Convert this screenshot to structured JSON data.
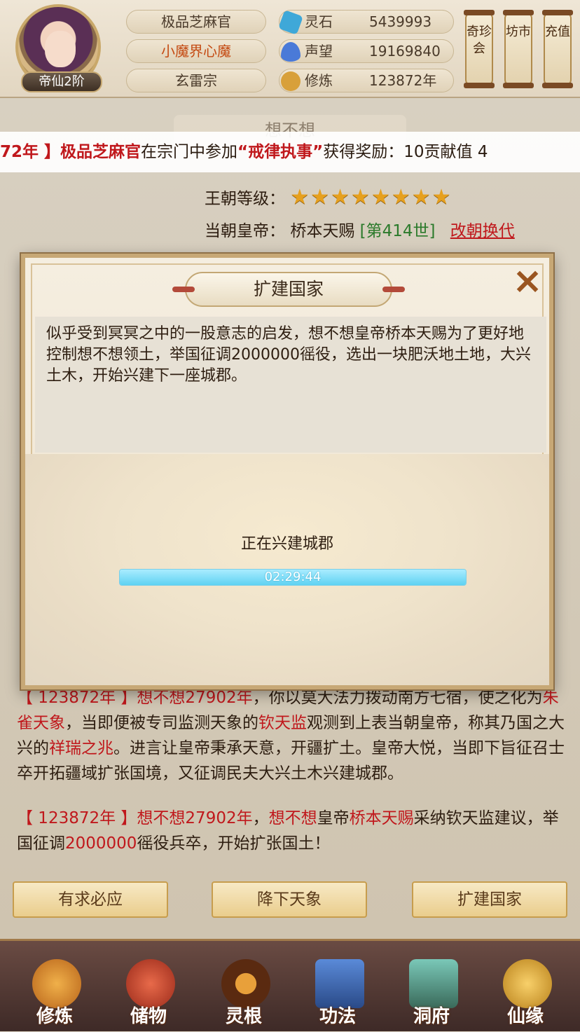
{
  "header": {
    "realm": "帝仙2阶",
    "title_pill": "极品芝麻官",
    "name_pill": "小魔界心魔",
    "sect_pill": "玄雷宗",
    "resources": [
      {
        "label": "灵石",
        "value": "5439993",
        "icon": "spirit-stone-icon",
        "color": "#3fa8d8"
      },
      {
        "label": "声望",
        "value": "19169840",
        "icon": "prestige-crystal-icon",
        "color": "#4a7ad8"
      },
      {
        "label": "修炼",
        "value": "123872年",
        "icon": "meditation-icon",
        "color": "#d8a03a"
      }
    ],
    "side_buttons": [
      "奇珍会",
      "坊市",
      "充值"
    ]
  },
  "page": {
    "title": "想不想",
    "ticker": {
      "part1": "72年 】",
      "name": "极品芝麻官",
      "part2": "在宗门中参加",
      "event": "“戒律执事”",
      "part3": "获得奖励：10贡献值 4"
    },
    "dynasty_level_label": "王朝等级：",
    "stars": 8,
    "emperor_label": "当朝皇帝：",
    "emperor_name": "桥本天赐",
    "generation": "[第414世]",
    "change_dynasty": "改朝换代"
  },
  "log": [
    {
      "segments": [
        {
          "t": "【 123872年 】想不想27902年",
          "c": "r"
        },
        {
          "t": "，你以莫大法力拨动南方七宿，使之",
          "c": ""
        },
        {
          "t": "化为",
          "c": ""
        },
        {
          "t": "朱雀天象",
          "c": "r"
        },
        {
          "t": "，当即便被专司监测天象的",
          "c": ""
        },
        {
          "t": "钦天监",
          "c": "r"
        },
        {
          "t": "观测到上表当朝皇帝，称其乃国之大兴的",
          "c": ""
        },
        {
          "t": "祥瑞之兆",
          "c": "r"
        },
        {
          "t": "。进言让皇帝秉承天意，开疆扩土。皇帝大悦，当即下旨征召士卒开拓疆域扩张国境，又征调民夫大兴土木兴建城郡。",
          "c": ""
        }
      ]
    },
    {
      "segments": [
        {
          "t": "【 123872年 】想不想27902年",
          "c": "r"
        },
        {
          "t": "，",
          "c": ""
        },
        {
          "t": "想不想",
          "c": "r"
        },
        {
          "t": "皇帝",
          "c": ""
        },
        {
          "t": "桥本天赐",
          "c": "r"
        },
        {
          "t": "采纳钦天监建议，举国征调",
          "c": ""
        },
        {
          "t": "2000000",
          "c": "r"
        },
        {
          "t": "徭役兵卒，开始扩张国土！",
          "c": ""
        }
      ]
    }
  ],
  "actions": [
    "有求必应",
    "降下天象",
    "扩建国家"
  ],
  "nav": [
    {
      "label": "修炼",
      "icon": "cultivate-icon",
      "color": "#d88a2a"
    },
    {
      "label": "储物",
      "icon": "storage-bag-icon",
      "color": "#c8402a"
    },
    {
      "label": "灵根",
      "icon": "spirit-root-icon",
      "color": "#7a3a1a"
    },
    {
      "label": "功法",
      "icon": "manual-book-icon",
      "color": "#3a6aa8"
    },
    {
      "label": "洞府",
      "icon": "cave-dwelling-icon",
      "color": "#4a8a7a"
    },
    {
      "label": "仙缘",
      "icon": "immortal-gourd-icon",
      "color": "#d8a03a"
    }
  ],
  "dialog": {
    "title": "扩建国家",
    "close": "×",
    "text": "似乎受到冥冥之中的一股意志的启发，想不想皇帝桥本天赐为了更好地控制想不想领土，举国征调2000000徭役，选出一块肥沃地土地，大兴土木，开始兴建下一座城郡。",
    "status": "正在兴建城郡",
    "timer": "02:29:44",
    "progress": 1.0
  }
}
